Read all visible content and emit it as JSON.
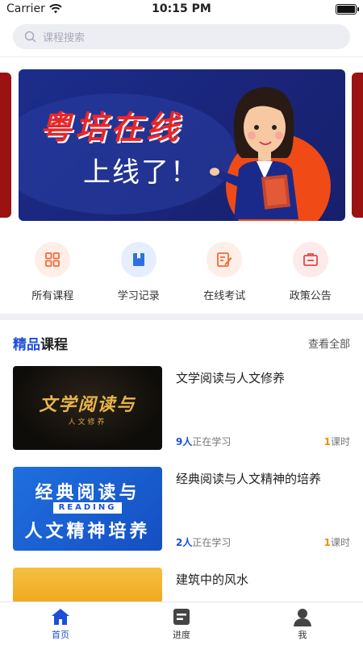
{
  "status": {
    "carrier": "Carrier",
    "time": "10:15 PM"
  },
  "search": {
    "placeholder": "课程搜索"
  },
  "banner": {
    "title": "粤培在线",
    "subtitle": "上线了！"
  },
  "quick": [
    {
      "label": "所有课程",
      "icon": "grid-icon",
      "color": "#f26b3a"
    },
    {
      "label": "学习记录",
      "icon": "book-icon",
      "color": "#2f6fe0"
    },
    {
      "label": "在线考试",
      "icon": "edit-icon",
      "color": "#f26b3a"
    },
    {
      "label": "政策公告",
      "icon": "notice-icon",
      "color": "#e04848"
    }
  ],
  "section": {
    "title_accent": "精品",
    "title_rest": "课程",
    "view_all": "查看全部"
  },
  "courses": [
    {
      "title": "文学阅读与人文修养",
      "learners": "9人",
      "learners_suffix": "正在学习",
      "lessons": "1",
      "lessons_suffix": "课时",
      "thumb_title": "文学阅读与",
      "thumb_sub": "人文修养"
    },
    {
      "title": "经典阅读与人文精神的培养",
      "learners": "2人",
      "learners_suffix": "正在学习",
      "lessons": "1",
      "lessons_suffix": "课时",
      "thumb_title1": "经典阅读与",
      "thumb_reading": "READING",
      "thumb_title2": "人文精神培养"
    },
    {
      "title": "建筑中的风水"
    }
  ],
  "tabs": [
    {
      "label": "首页",
      "icon": "home-icon",
      "active": true
    },
    {
      "label": "进度",
      "icon": "progress-icon",
      "active": false
    },
    {
      "label": "我",
      "icon": "profile-icon",
      "active": false
    }
  ],
  "colors": {
    "accent": "#1d4fd8",
    "orange": "#f08a00"
  }
}
